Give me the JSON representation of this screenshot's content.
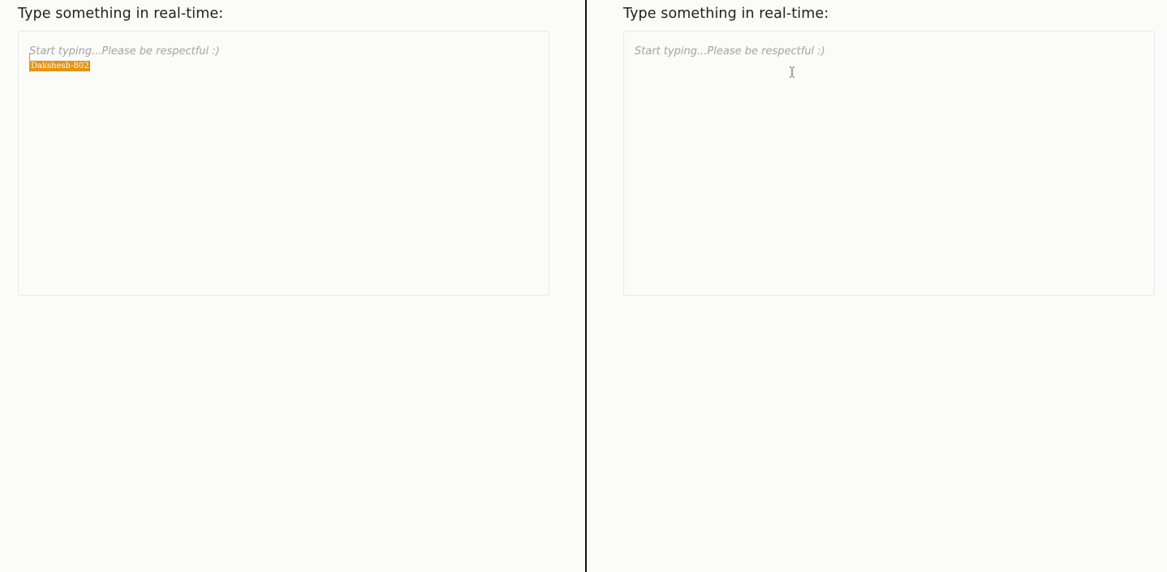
{
  "left_pane": {
    "heading": "Type something in real-time:",
    "editor": {
      "placeholder": "Start typing...Please be respectful :)",
      "remote_cursor": {
        "username": "Dakshesh-802",
        "color": "#e8920f"
      }
    }
  },
  "right_pane": {
    "heading": "Type something in real-time:",
    "editor": {
      "placeholder": "Start typing...Please be respectful :)",
      "mouse_pointer_icon": "text-cursor-icon"
    }
  },
  "colors": {
    "background": "#fbfbfa",
    "divider": "#111111",
    "editor_border": "#e6e8ec",
    "placeholder_text": "#a4a4a4",
    "heading_text": "#1f1f1f"
  }
}
